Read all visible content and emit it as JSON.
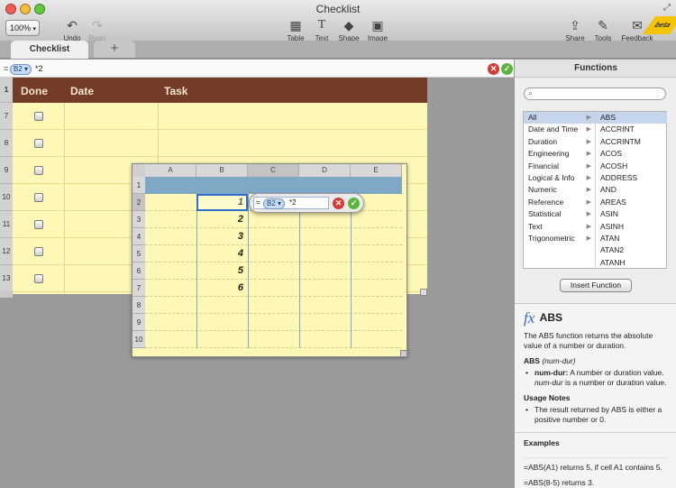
{
  "window": {
    "title": "Checklist"
  },
  "toolbar": {
    "zoom": "100%",
    "undo": "Undo",
    "redo": "Redo",
    "table": "Table",
    "text": "Text",
    "shape": "Shape",
    "image": "Image",
    "share": "Share",
    "tools": "Tools",
    "feedback": "Feedback",
    "beta": "beta"
  },
  "tabs": {
    "active": "Checklist",
    "add": "+"
  },
  "formula_bar": {
    "prefix": "=",
    "token": "B2",
    "rest": "*2"
  },
  "sheet1": {
    "headers": {
      "done": "Done",
      "date": "Date",
      "task": "Task"
    },
    "header_row": "1",
    "rows": [
      "7",
      "8",
      "9",
      "10",
      "11",
      "12",
      "13"
    ]
  },
  "sheet2": {
    "columns": [
      "A",
      "B",
      "C",
      "D",
      "E"
    ],
    "rows": [
      "1",
      "2",
      "3",
      "4",
      "5",
      "6",
      "7",
      "8",
      "9",
      "10"
    ],
    "b_values": [
      "1",
      "2",
      "3",
      "4",
      "5",
      "6"
    ]
  },
  "inline_editor": {
    "prefix": "=",
    "token": "B2",
    "rest": "*2"
  },
  "functions_panel": {
    "title": "Functions",
    "categories": [
      "All",
      "Date and Time",
      "Duration",
      "Engineering",
      "Financial",
      "Logical & Info",
      "Numeric",
      "Reference",
      "Statistical",
      "Text",
      "Trigonometric"
    ],
    "functions": [
      "ABS",
      "ACCRINT",
      "ACCRINTM",
      "ACOS",
      "ACOSH",
      "ADDRESS",
      "AND",
      "AREAS",
      "ASIN",
      "ASINH",
      "ATAN",
      "ATAN2",
      "ATANH"
    ],
    "insert_button": "Insert Function",
    "help": {
      "fx": "fx",
      "name": "ABS",
      "description": "The ABS function returns the absolute value of a number or duration.",
      "syntax_name": "ABS",
      "syntax_arg": "(num-dur)",
      "arg_label": "num-dur:",
      "arg_desc_1": "A number or duration value.",
      "arg_desc_2_italic": "num-dur",
      "arg_desc_2": "is a number or duration value.",
      "usage_title": "Usage Notes",
      "usage_note": "The result returned by ABS is either a positive number or 0.",
      "examples_title": "Examples",
      "example_1": "=ABS(A1) returns 5, if cell A1 contains 5.",
      "example_2": "=ABS(8-5) returns 3."
    }
  },
  "colors": {
    "header_brown": "#733c28",
    "sheet_yellow": "#fdf8b6",
    "accent_blue": "#2e6fd0",
    "cancel_red": "#d83a35",
    "accept_green": "#5bb43b"
  }
}
